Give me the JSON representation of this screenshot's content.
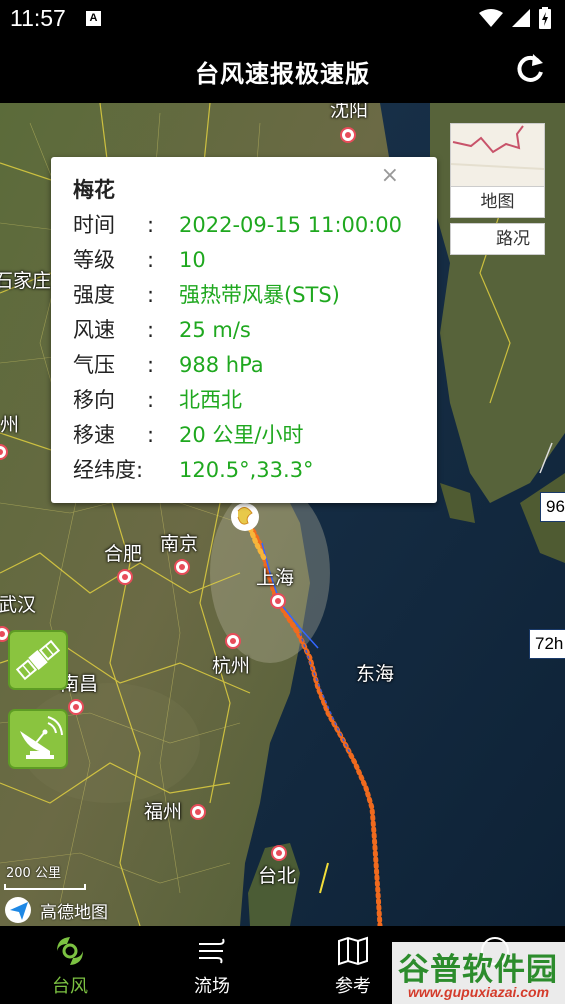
{
  "status_bar": {
    "time": "11:57",
    "notification_icon": "A"
  },
  "header": {
    "title": "台风速报极速版"
  },
  "popup": {
    "title": "梅花",
    "close": "×",
    "rows": [
      {
        "label": "时间",
        "sep": ":",
        "value": "2022-09-15 11:00:00"
      },
      {
        "label": "等级",
        "sep": ":",
        "value": "10"
      },
      {
        "label": "强度",
        "sep": ":",
        "value": "强热带风暴(STS)"
      },
      {
        "label": "风速",
        "sep": ":",
        "value": "25 m/s"
      },
      {
        "label": "气压",
        "sep": ":",
        "value": "988 hPa"
      },
      {
        "label": "移向",
        "sep": ":",
        "value": "北西北"
      },
      {
        "label": "移速",
        "sep": ":",
        "value": "20 公里/小时"
      },
      {
        "label": "经纬度:",
        "sep": "",
        "value": "120.5°,33.3°"
      }
    ]
  },
  "layers": {
    "map_label": "地图",
    "road_label": "路况"
  },
  "map": {
    "cities": {
      "shenyang": "沈阳",
      "shijiazhuang": "石家庄",
      "zhou": "州",
      "nanjing": "南京",
      "hefei": "合肥",
      "shanghai": "上海",
      "wuhan": "武汉",
      "hangzhou": "杭州",
      "nanchang": "南昌",
      "fuzhou": "福州",
      "taibei": "台北",
      "donghai": "东海"
    },
    "time_tags": {
      "t96": "96",
      "t72": "72h"
    },
    "scale": "200 公里",
    "logo": "高德地图"
  },
  "nav": {
    "items": [
      {
        "label": "台风"
      },
      {
        "label": "流场"
      },
      {
        "label": "参考"
      }
    ]
  },
  "watermark": {
    "main": "谷普软件园",
    "url": "www.gupuxiazai.com"
  },
  "colors": {
    "accent_green": "#1fa81f",
    "track_orange": "#f06a1e",
    "nav_active": "#7cc242"
  }
}
